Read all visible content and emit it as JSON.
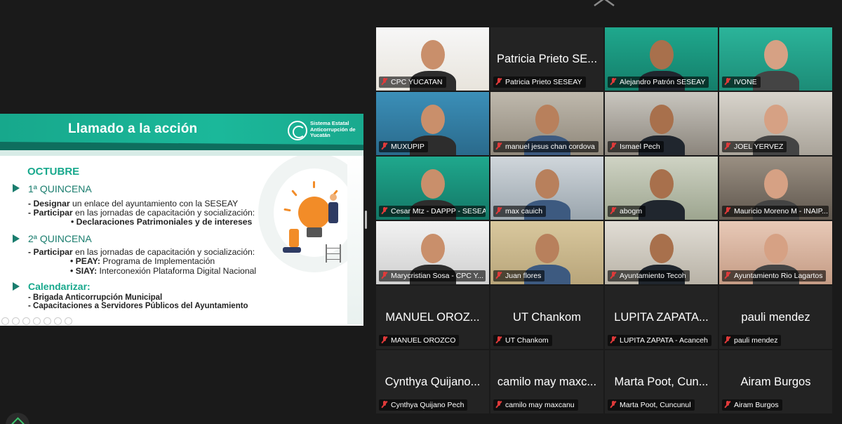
{
  "slide": {
    "title": "Llamado a la acción",
    "logo_text": "Sistema Estatal Anticorrupción de Yucatán",
    "month": "OCTUBRE",
    "q1_title": "1ª QUINCENA",
    "q1_line1_bold": "- Designar",
    "q1_line1_rest": " un enlace del ayuntamiento con la SESEAY",
    "q1_line2_bold": "- Participar",
    "q1_line2_rest": " en las jornadas de capacitación y socialización:",
    "q1_line3": "• Declaraciones Patrimoniales y de intereses",
    "q2_title": "2ª QUINCENA",
    "q2_line1_bold": "- Participar",
    "q2_line1_rest": " en las jornadas de capacitación y socialización:",
    "q2_line2_bold": "• PEAY:",
    "q2_line2_rest": " Programa de Implementación",
    "q2_line3_bold": "• SIAY:",
    "q2_line3_rest": " Interconexión Plataforma Digital Nacional",
    "cal_title": "Calendarizar:",
    "cal_line1": "- Brigada Anticorrupción Municipal",
    "cal_line2": "- Capacitaciones a Servidores Públicos del Ayuntamiento"
  },
  "participants": [
    {
      "label": "CPC YUCATAN",
      "big": ""
    },
    {
      "label": "Patricia Prieto SESEAY",
      "big": "Patricia Prieto SE..."
    },
    {
      "label": "Alejandro Patrón SESEAY",
      "big": ""
    },
    {
      "label": "IVONE",
      "big": ""
    },
    {
      "label": "MUXUPIP",
      "big": ""
    },
    {
      "label": "manuel jesus chan cordova",
      "big": ""
    },
    {
      "label": "Ismael Pech",
      "big": ""
    },
    {
      "label": "JOEL YERVEZ",
      "big": ""
    },
    {
      "label": "Cesar Mtz - DAPPP - SESEAY",
      "big": ""
    },
    {
      "label": "max cauich",
      "big": ""
    },
    {
      "label": "abogm",
      "big": ""
    },
    {
      "label": "Mauricio Moreno M - INAIP...",
      "big": ""
    },
    {
      "label": "Marycristian Sosa - CPC Y...",
      "big": ""
    },
    {
      "label": "Juan flores",
      "big": ""
    },
    {
      "label": "Ayuntamiento Tecoh",
      "big": ""
    },
    {
      "label": "Ayuntamiento Rio Lagartos",
      "big": ""
    },
    {
      "label": "MANUEL OROZCO",
      "big": "MANUEL OROZ..."
    },
    {
      "label": "UT Chankom",
      "big": "UT Chankom"
    },
    {
      "label": "LUPITA ZAPATA - Acanceh",
      "big": "LUPITA ZAPATA..."
    },
    {
      "label": "pauli mendez",
      "big": "pauli mendez"
    },
    {
      "label": "Cynthya Quijano Pech",
      "big": "Cynthya Quijano..."
    },
    {
      "label": "camilo may maxcanu",
      "big": "camilo may maxc..."
    },
    {
      "label": "Marta Poot, Cuncunul",
      "big": "Marta Poot, Cun..."
    },
    {
      "label": "Airam Burgos",
      "big": "Airam Burgos"
    }
  ],
  "icons": [
    "chevron-up-icon",
    "mic-muted-icon",
    "logo-icon"
  ],
  "colors": {
    "accent": "#17a88c",
    "muted_mic": "#e03a3a",
    "active_speaker": "#2fbf4a",
    "background": "#1a1a1a"
  }
}
